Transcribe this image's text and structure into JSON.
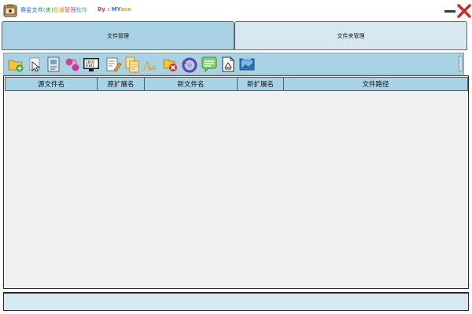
{
  "window": {
    "title_parts": [
      "赛星文件",
      "(夹)",
      "批量",
      "管理",
      "软件"
    ],
    "byline_parts": [
      "By",
      " : ",
      "MY",
      "sce"
    ],
    "colors": {
      "accent": "#a9d2e4",
      "tab_inactive": "#d8e8f0",
      "close": "#cc2a2a"
    }
  },
  "tabs": [
    {
      "label": "文件管理",
      "active": true
    },
    {
      "label": "文件夹管理",
      "active": false
    }
  ],
  "toolbar": {
    "icons": [
      "add-folder-icon",
      "cursor-select-icon",
      "document-list-icon",
      "replace-circles-icon",
      "binary-monitor-icon",
      "edit-document-icon",
      "copy-files-icon",
      "font-case-icon",
      "delete-file-icon",
      "rotate-undo-icon",
      "comment-note-icon",
      "convert-document-icon",
      "export-image-icon"
    ]
  },
  "table": {
    "columns": [
      "源文件名",
      "原扩展名",
      "新文件名",
      "新扩展名",
      "文件路径"
    ],
    "rows": []
  },
  "status": {
    "text": ""
  }
}
